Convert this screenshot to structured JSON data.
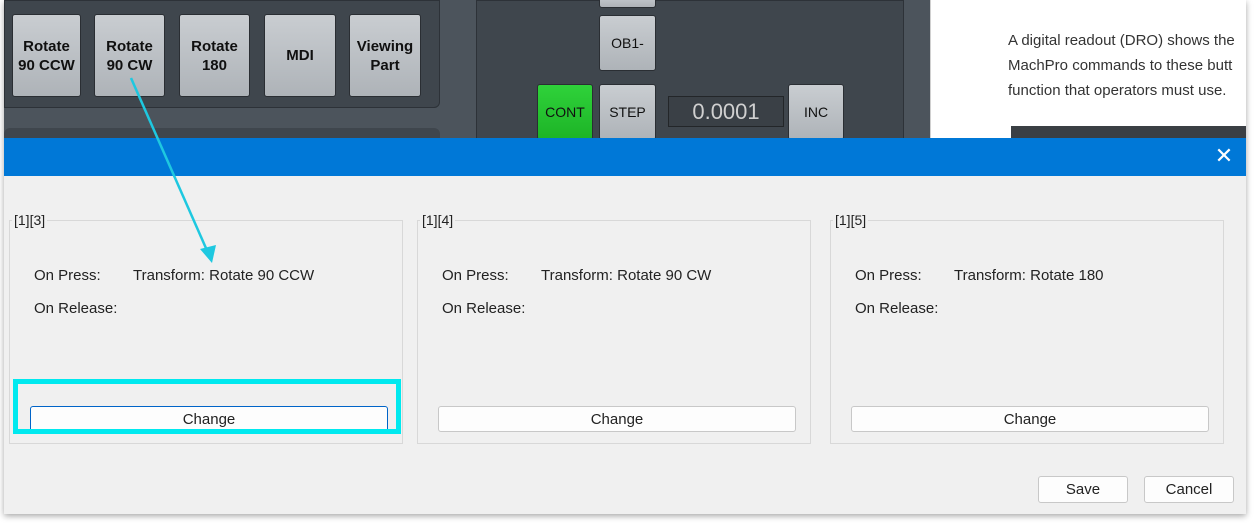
{
  "machine_panel": {
    "buttons": [
      {
        "label": "Rotate\n90 CCW"
      },
      {
        "label": "Rotate\n90 CW"
      },
      {
        "label": "Rotate\n180"
      },
      {
        "label": "MDI"
      },
      {
        "label": "Viewing\nPart"
      }
    ],
    "ob1_label": "OB1-",
    "cont_label": "CONT",
    "step_label": "STEP",
    "increment_value": "0.0001",
    "inc_label": "INC"
  },
  "document": {
    "lines": [
      "A digital readout (DRO) shows the",
      "MachPro commands to these butt",
      "function that operators must use."
    ]
  },
  "dialog": {
    "groups": [
      {
        "legend": "[1][3]",
        "on_press_label": "On Press:",
        "on_press_value": "Transform: Rotate 90 CCW",
        "on_release_label": "On Release:",
        "change_label": "Change"
      },
      {
        "legend": "[1][4]",
        "on_press_label": "On Press:",
        "on_press_value": "Transform: Rotate 90 CW",
        "on_release_label": "On Release:",
        "change_label": "Change"
      },
      {
        "legend": "[1][5]",
        "on_press_label": "On Press:",
        "on_press_value": "Transform: Rotate 180",
        "on_release_label": "On Release:",
        "change_label": "Change"
      }
    ],
    "save_label": "Save",
    "cancel_label": "Cancel",
    "close_symbol": "✕"
  },
  "colors": {
    "titlebar": "#0078d7",
    "highlight": "#00e9ef",
    "arrow": "#1ec8e0"
  }
}
